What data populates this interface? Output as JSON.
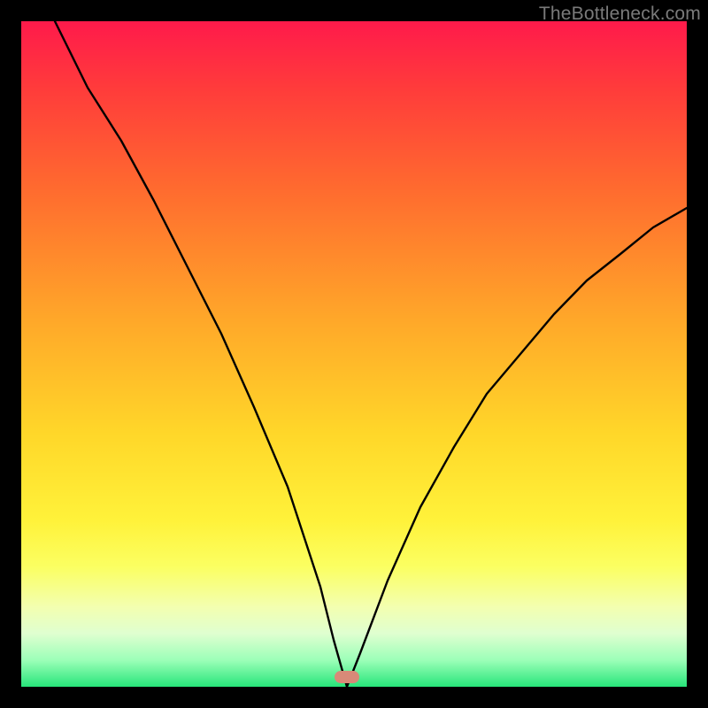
{
  "watermark": {
    "text": "TheBottleneck.com"
  },
  "marker": {
    "x_fraction": 0.49,
    "y_fraction": 0.985
  },
  "chart_data": {
    "type": "line",
    "title": "",
    "xlabel": "",
    "ylabel": "",
    "xlim": [
      0,
      100
    ],
    "ylim": [
      0,
      100
    ],
    "grid": false,
    "legend": false,
    "x": [
      5,
      10,
      15,
      20,
      25,
      30,
      35,
      40,
      45,
      47,
      49,
      51,
      55,
      60,
      65,
      70,
      75,
      80,
      85,
      90,
      95,
      100
    ],
    "values": [
      100,
      90,
      82,
      73,
      63,
      53,
      42,
      30,
      15,
      7,
      0,
      5,
      16,
      27,
      36,
      44,
      50,
      56,
      61,
      65,
      69,
      72
    ],
    "annotations": [
      {
        "type": "marker",
        "x": 49,
        "y": 0,
        "shape": "pill",
        "color": "#d88a78"
      }
    ],
    "description": "V-shaped bottleneck curve over vertical red-to-green gradient; minimum (optimal point) near x≈49%."
  }
}
